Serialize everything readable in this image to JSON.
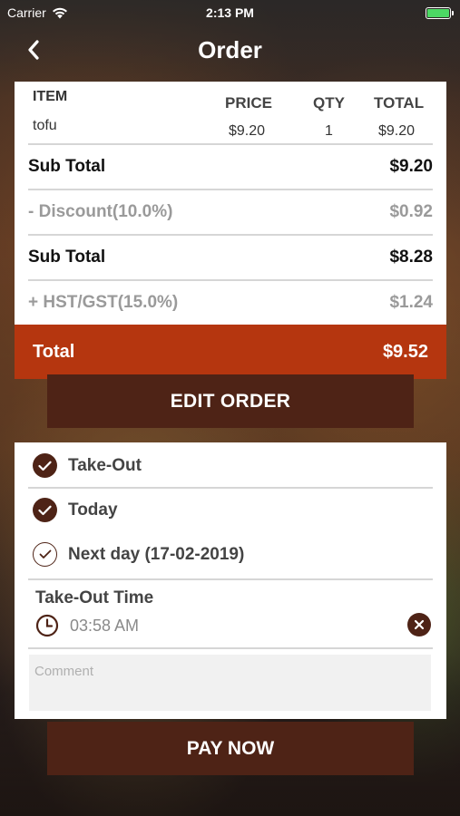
{
  "status_bar": {
    "carrier": "Carrier",
    "time": "2:13 PM"
  },
  "nav": {
    "title": "Order"
  },
  "order": {
    "headers": {
      "item": "ITEM",
      "price": "PRICE",
      "qty": "QTY",
      "total": "TOTAL"
    },
    "lines": [
      {
        "name": "tofu",
        "price": "$9.20",
        "qty": "1",
        "total": "$9.20"
      }
    ],
    "summary": [
      {
        "label": "Sub Total",
        "value": "$9.20"
      },
      {
        "label": "- Discount(10.0%)",
        "value": "$0.92"
      },
      {
        "label": "Sub Total",
        "value": "$8.28"
      },
      {
        "label": "+ HST/GST(15.0%)",
        "value": "$1.24"
      }
    ],
    "total": {
      "label": "Total",
      "value": "$9.52"
    }
  },
  "edit_button": "EDIT ORDER",
  "options": {
    "items": [
      {
        "label": "Take-Out",
        "checked": true
      },
      {
        "label": "Today",
        "checked": true
      },
      {
        "label": "Next day (17-02-2019)",
        "checked": false
      }
    ],
    "time_label": "Take-Out Time",
    "time_value": "03:58 AM",
    "comment_placeholder": "Comment"
  },
  "pay_button": "PAY NOW",
  "colors": {
    "brand_dark": "#4e2316",
    "total_bar": "#b5360f",
    "battery": "#4cd964"
  }
}
